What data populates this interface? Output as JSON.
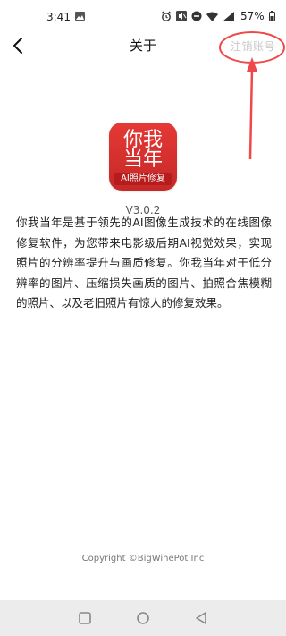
{
  "status_bar": {
    "time": "3:41",
    "battery": "57%",
    "icons": [
      "image-icon",
      "alarm-icon",
      "volume-mute-icon",
      "do-not-disturb-icon",
      "wifi-icon",
      "signal-icon",
      "battery-icon"
    ]
  },
  "header": {
    "title": "关于",
    "right_action": "注销账号"
  },
  "app": {
    "icon_line1": "你我",
    "icon_line2": "当年",
    "icon_band": "AI照片修复",
    "version": "V3.0.2"
  },
  "description": "你我当年是基于领先的AI图像生成技术的在线图像修复软件，为您带来电影级后期AI视觉效果，实现照片的分辨率提升与画质修复。你我当年对于低分辨率的图片、压缩损失画质的图片、拍照合焦模糊的照片、以及老旧照片有惊人的修复效果。",
  "footer": {
    "copyright": "Copyright ©BigWinePot Inc"
  },
  "nav_bar": {
    "icons": [
      "recents-icon",
      "home-icon",
      "back-icon"
    ]
  },
  "colors": {
    "annotation_red": "#f04848",
    "app_red": "#d32f2f",
    "disabled_text": "#c8c8c8"
  }
}
